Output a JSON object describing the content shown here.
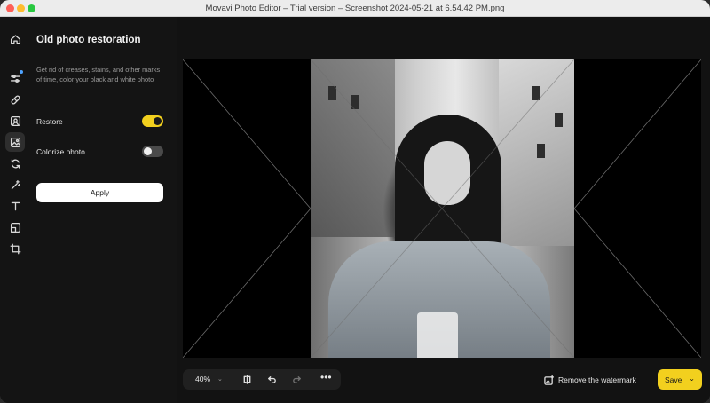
{
  "window": {
    "title": "Movavi Photo Editor – Trial version – Screenshot 2024-05-21 at 6.54.42 PM.png"
  },
  "toolbar": {
    "items": [
      {
        "name": "home",
        "icon": "home-icon"
      },
      {
        "name": "adjust",
        "icon": "sliders-icon"
      },
      {
        "name": "retouch",
        "icon": "bandage-icon"
      },
      {
        "name": "portrait",
        "icon": "portrait-icon"
      },
      {
        "name": "photo-restoration",
        "icon": "image-restore-icon",
        "active": true
      },
      {
        "name": "replace",
        "icon": "replace-icon"
      },
      {
        "name": "magic",
        "icon": "magic-wand-icon"
      },
      {
        "name": "text",
        "icon": "text-icon"
      },
      {
        "name": "resize",
        "icon": "resize-icon"
      },
      {
        "name": "crop",
        "icon": "crop-icon"
      }
    ]
  },
  "panel": {
    "title": "Old photo restoration",
    "description": "Get rid of creases, stains, and other marks of time, color your black and white photo",
    "options": [
      {
        "label": "Restore",
        "enabled": true
      },
      {
        "label": "Colorize photo",
        "enabled": false
      }
    ],
    "apply_label": "Apply"
  },
  "bottom": {
    "zoom": "40%",
    "watermark_label": "Remove the watermark",
    "save_label": "Save",
    "more_label": "•••"
  },
  "colors": {
    "accent": "#f2d01e",
    "background": "#121212",
    "panel": "#141414"
  }
}
